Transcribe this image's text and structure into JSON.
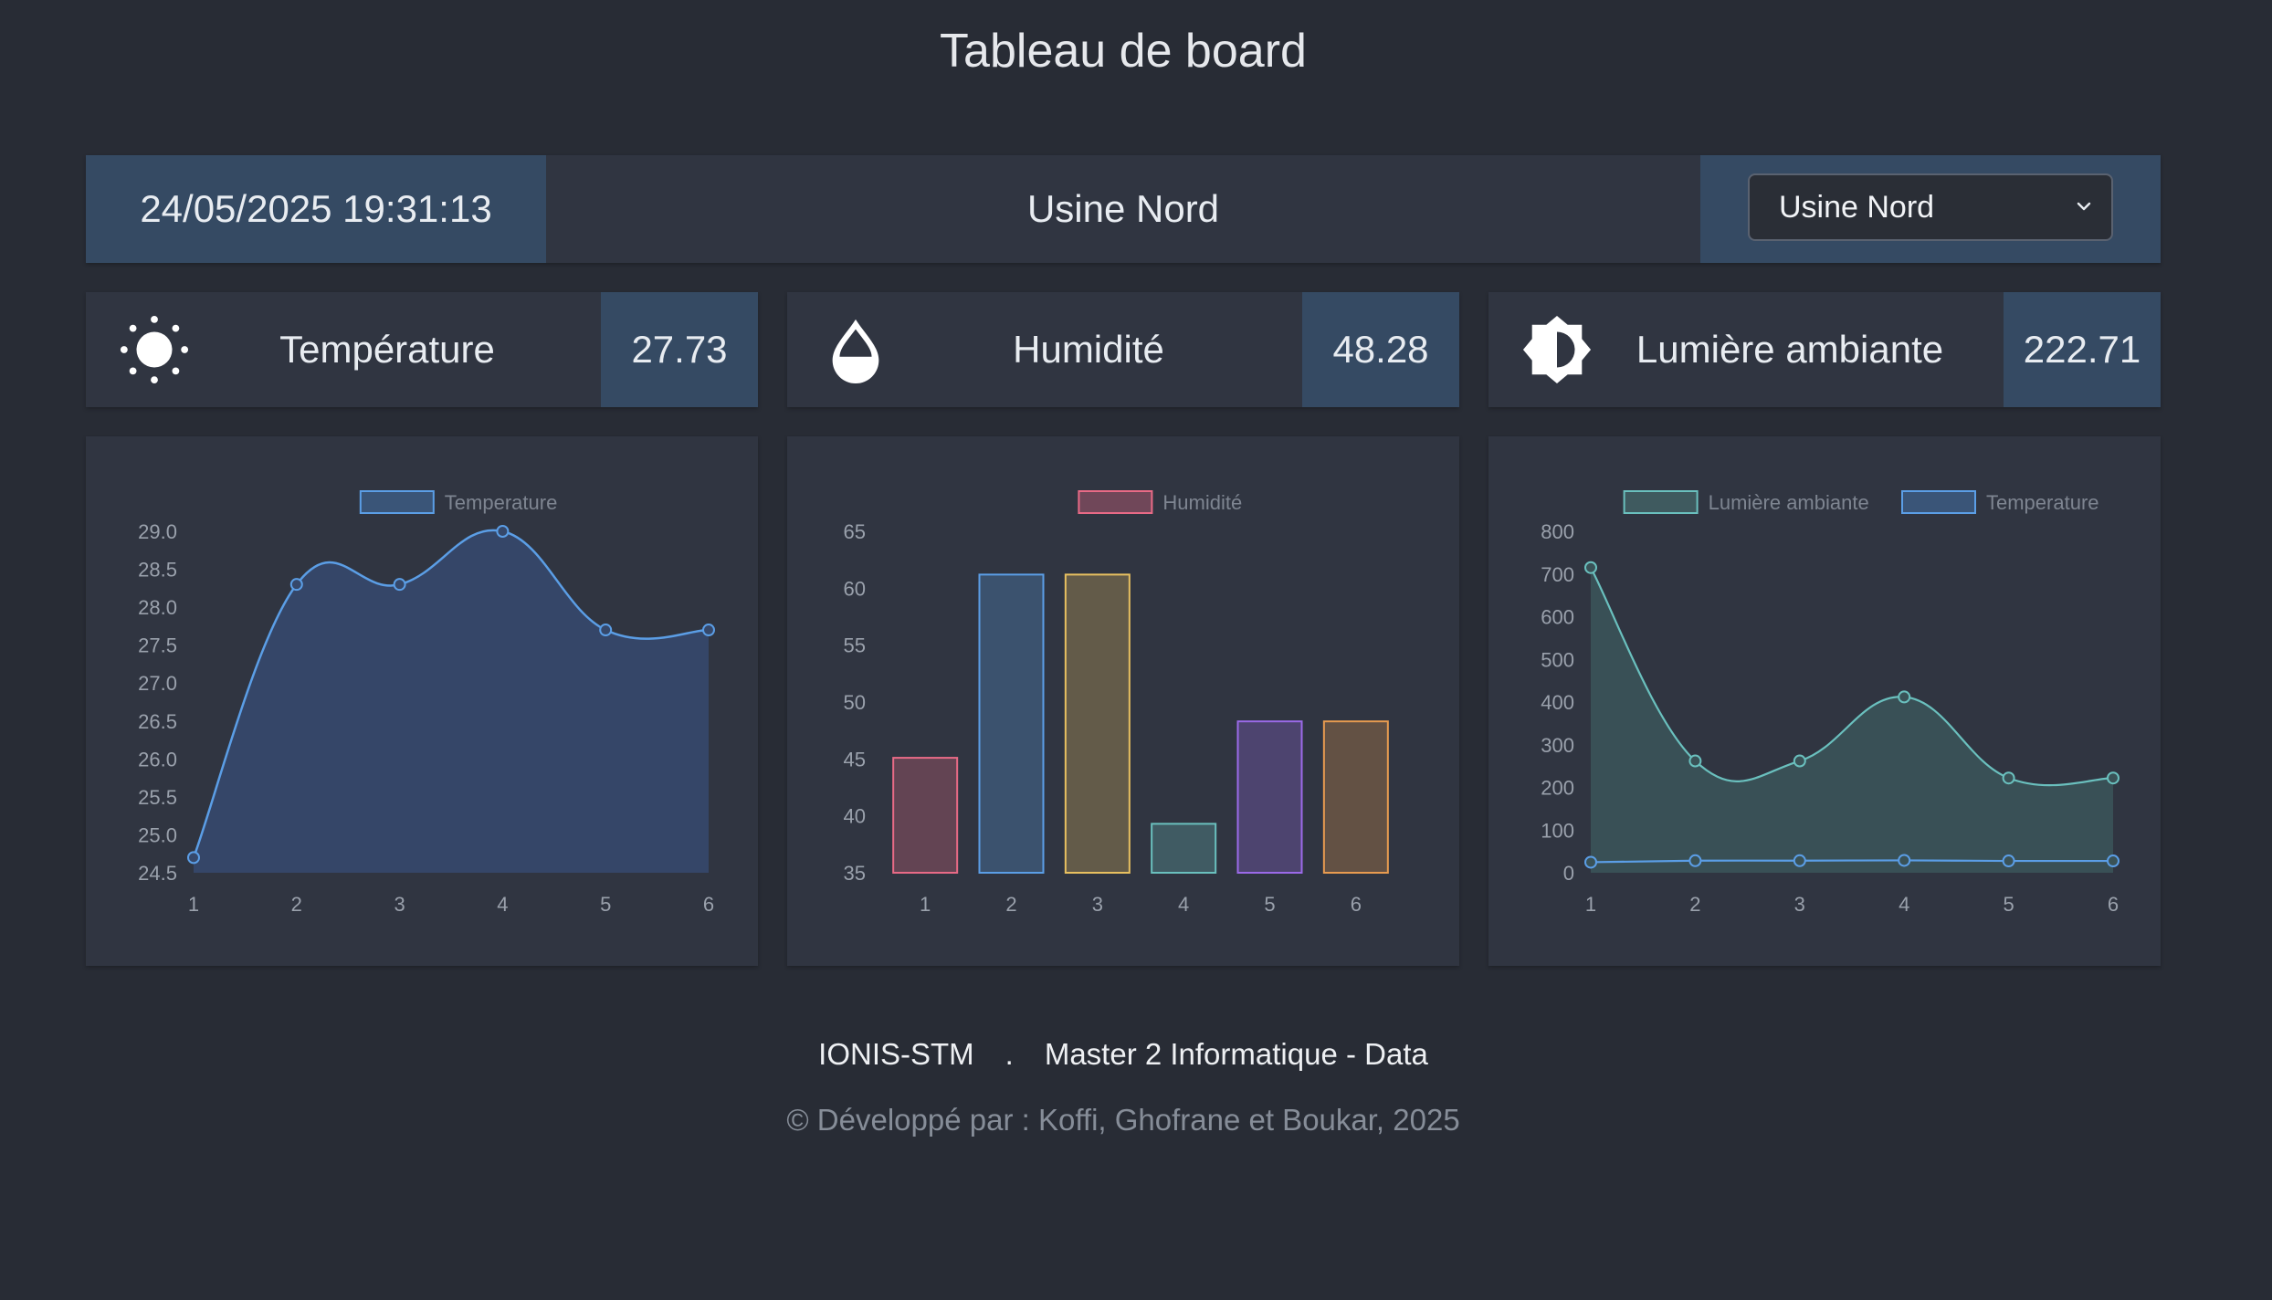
{
  "page": {
    "title": "Tableau de board"
  },
  "header": {
    "datetime": "24/05/2025 19:31:13",
    "site": "Usine Nord",
    "site_select": {
      "selected": "Usine Nord"
    }
  },
  "stats": [
    {
      "label": "Température",
      "value": "27.73",
      "icon": "sun-icon"
    },
    {
      "label": "Humidité",
      "value": "48.28",
      "icon": "water-drop-icon"
    },
    {
      "label": "Lumière ambiante",
      "value": "222.71",
      "icon": "brightness-icon"
    }
  ],
  "footer": {
    "school": "IONIS-STM",
    "separator": ".",
    "program": "Master 2 Informatique - Data",
    "credits": "© Développé par : Koffi, Ghofrane et Boukar, 2025"
  },
  "chart_data": [
    {
      "type": "line",
      "x": [
        1,
        2,
        3,
        4,
        5,
        6
      ],
      "series": [
        {
          "name": "Temperature",
          "values": [
            24.7,
            28.3,
            28.3,
            29.0,
            27.7,
            27.7
          ],
          "color": "#5b9ee6"
        }
      ],
      "ylim": [
        24.5,
        29.0
      ],
      "yticks": [
        "29.0",
        "28.5",
        "28.0",
        "27.5",
        "27.0",
        "26.5",
        "26.0",
        "25.5",
        "25.0",
        "24.5"
      ],
      "legend": "top"
    },
    {
      "type": "bar",
      "categories": [
        "1",
        "2",
        "3",
        "4",
        "5",
        "6"
      ],
      "series": [
        {
          "name": "Humidité",
          "values": [
            45.1,
            61.2,
            61.2,
            39.3,
            48.3,
            48.3
          ]
        }
      ],
      "colors": [
        "#e86a86",
        "#5b9ee6",
        "#e8c060",
        "#6ac0be",
        "#9b6ae8",
        "#e89b50"
      ],
      "ylim": [
        35,
        65
      ],
      "yticks": [
        "65",
        "60",
        "55",
        "50",
        "45",
        "40",
        "35"
      ],
      "legend": "top",
      "legend_color": "#e86a86"
    },
    {
      "type": "area",
      "x": [
        1,
        2,
        3,
        4,
        5,
        6
      ],
      "series": [
        {
          "name": "Lumière ambiante",
          "values": [
            715,
            262,
            262,
            412,
            222,
            222
          ],
          "color": "#6ac0be"
        },
        {
          "name": "Temperature",
          "values": [
            24.7,
            28.3,
            28.3,
            29.0,
            27.7,
            27.7
          ],
          "color": "#5b9ee6"
        }
      ],
      "ylim": [
        0,
        800
      ],
      "yticks": [
        "800",
        "700",
        "600",
        "500",
        "400",
        "300",
        "200",
        "100",
        "0"
      ],
      "legend": "top"
    }
  ]
}
